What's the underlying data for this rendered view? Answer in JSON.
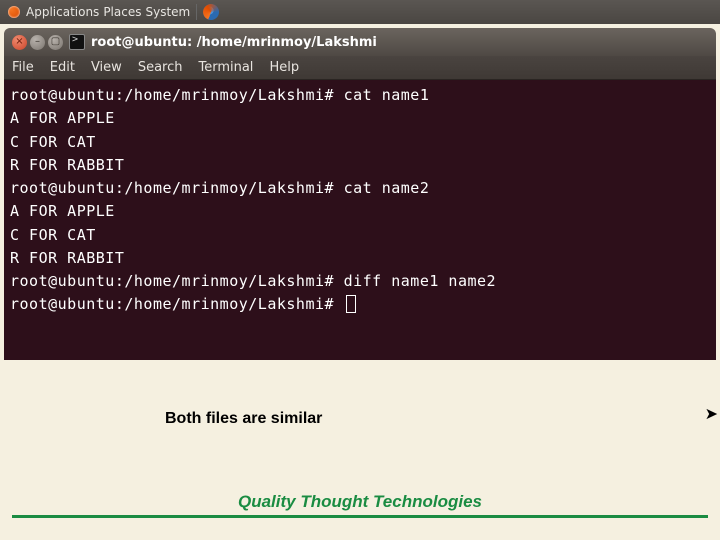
{
  "top_panel": {
    "menus": [
      "Applications",
      "Places",
      "System"
    ]
  },
  "window": {
    "title": "root@ubuntu: /home/mrinmoy/Lakshmi"
  },
  "menubar": [
    "File",
    "Edit",
    "View",
    "Search",
    "Terminal",
    "Help"
  ],
  "terminal": {
    "prompt": "root@ubuntu:/home/mrinmoy/Lakshmi#",
    "lines": [
      {
        "type": "cmd",
        "text": "cat name1"
      },
      {
        "type": "out",
        "text": "A FOR APPLE"
      },
      {
        "type": "out",
        "text": "C FOR CAT"
      },
      {
        "type": "out",
        "text": "R FOR RABBIT"
      },
      {
        "type": "cmd",
        "text": "cat name2"
      },
      {
        "type": "out",
        "text": "A FOR APPLE"
      },
      {
        "type": "out",
        "text": "C FOR CAT"
      },
      {
        "type": "out",
        "text": "R FOR RABBIT"
      },
      {
        "type": "cmd",
        "text": "diff name1 name2"
      },
      {
        "type": "cmd_cursor",
        "text": ""
      }
    ]
  },
  "caption": "Both files are similar",
  "footer": "Quality Thought Technologies"
}
